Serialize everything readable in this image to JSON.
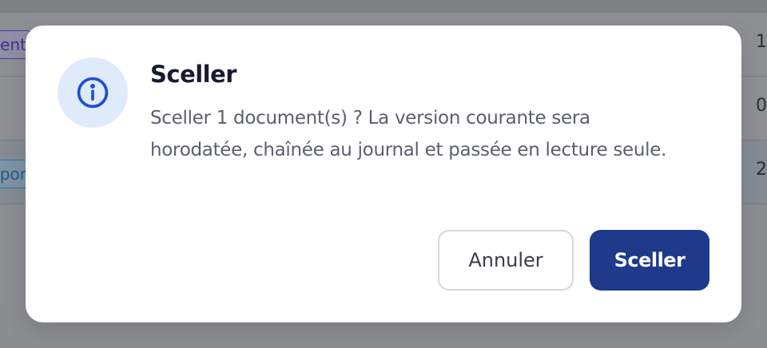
{
  "background": {
    "row1_tag": "ent",
    "row3_tag": "por",
    "row_values": [
      "1",
      "0",
      "2"
    ]
  },
  "dialog": {
    "icon": "info-icon",
    "title": "Sceller",
    "message": "Sceller 1 document(s) ? La version courante sera horodatée, chaînée au journal et passée en lecture seule.",
    "cancel_label": "Annuler",
    "confirm_label": "Sceller"
  },
  "colors": {
    "accent": "#1f3a8a",
    "icon_bg": "#dfeafb",
    "icon_stroke": "#1e4fd0"
  }
}
